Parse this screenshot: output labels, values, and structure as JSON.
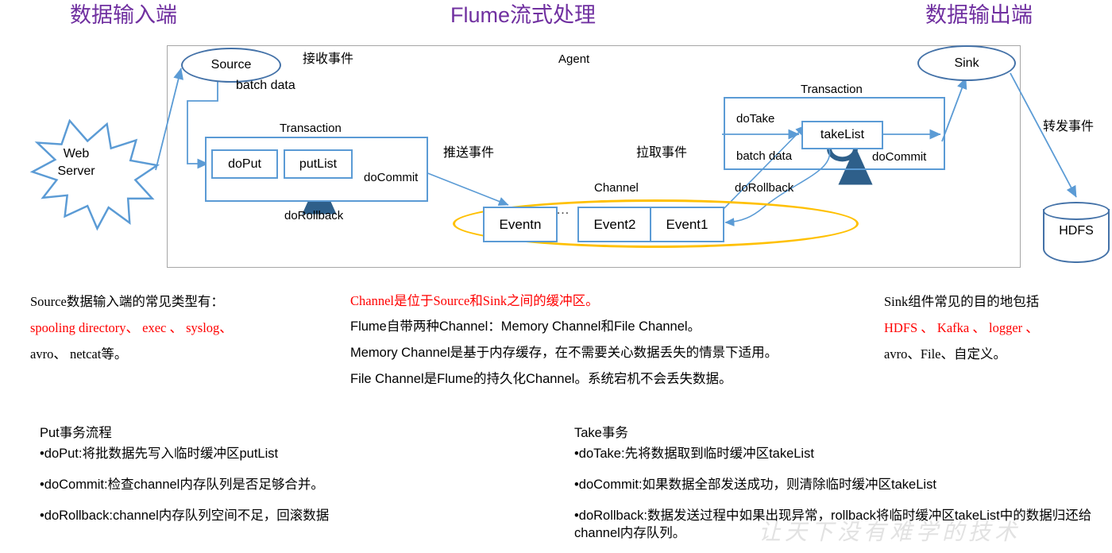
{
  "titles": {
    "left": "数据输入端",
    "center": "Flume流式处理",
    "right": "数据输出端",
    "color": "#7030A0"
  },
  "diagram": {
    "agent_label": "Agent",
    "source": "Source",
    "sink": "Sink",
    "web_server": "Web\nServer",
    "web_server_line1": "Web",
    "web_server_line2": "Server",
    "hdfs": "HDFS",
    "channel_label": "Channel",
    "receive_event": "接收事件",
    "push_event": "推送事件",
    "pull_event": "拉取事件",
    "forward_event": "转发事件",
    "batch_data_left": "batch data",
    "put_transaction": {
      "title": "Transaction",
      "do_put": "doPut",
      "put_list": "putList",
      "do_commit": "doCommit",
      "do_rollback": "doRollback"
    },
    "take_transaction": {
      "title": "Transaction",
      "do_take": "doTake",
      "take_list": "takeList",
      "batch_data": "batch data",
      "do_commit": "doCommit",
      "do_rollback": "doRollback"
    },
    "events": [
      "Eventn",
      "Event2",
      "Event1"
    ],
    "event_ellipsis": "…",
    "colors": {
      "blue": "#4472a8",
      "light_blue": "#5b9bd5",
      "yellow": "#ffc000",
      "gray_border": "#a6a6a6",
      "arrow_dark": "#2e5f8a"
    }
  },
  "notes": {
    "source": {
      "line1": "Source数据输入端的常见类型有：",
      "line2_red": "spooling directory、 exec 、 syslog、",
      "line3": "avro、 netcat等。"
    },
    "channel": {
      "line1_red": "Channel是位于Source和Sink之间的缓冲区。",
      "line2": "Flume自带两种Channel：Memory Channel和File Channel。",
      "line3": "Memory Channel是基于内存缓存，在不需要关心数据丢失的情景下适用。",
      "line4": "File Channel是Flume的持久化Channel。系统宕机不会丢失数据。"
    },
    "sink": {
      "line1": "Sink组件常见的目的地包括",
      "line2_red": "HDFS 、 Kafka 、 logger 、",
      "line3": "avro、File、自定义。"
    }
  },
  "transactions": {
    "put": {
      "heading": "Put事务流程",
      "items": [
        "•doPut:将批数据先写入临时缓冲区putList",
        "•doCommit:检查channel内存队列是否足够合并。",
        "•doRollback:channel内存队列空间不足，回滚数据"
      ]
    },
    "take": {
      "heading": " Take事务",
      "items": [
        "•doTake:先将数据取到临时缓冲区takeList",
        "•doCommit:如果数据全部发送成功，则清除临时缓冲区takeList",
        "•doRollback:数据发送过程中如果出现异常，rollback将临时缓冲区takeList中的数据归还给channel内存队列。"
      ]
    }
  },
  "watermark": "让天下没有难学的技术"
}
